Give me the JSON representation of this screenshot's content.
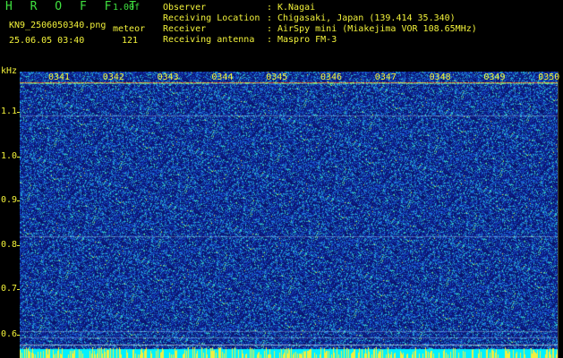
{
  "header": {
    "brand": "H R O F F T",
    "version": "1.00f",
    "filename": "KN9_2506050340.png",
    "timestamp": "25.06.05 03:40",
    "meteor_label": "meteor",
    "meteor_count": "121"
  },
  "metadata": [
    {
      "label": "Observer",
      "value": "K.Nagai"
    },
    {
      "label": "Receiving Location",
      "value": "Chigasaki, Japan (139.414 35.340)"
    },
    {
      "label": "Receiver",
      "value": "AirSpy mini (Miakejima VOR 108.65MHz)"
    },
    {
      "label": "Receiving antenna",
      "value": "Maspro FM-3"
    }
  ],
  "colon": ":",
  "y_axis": {
    "unit": "kHz",
    "ticks": [
      "1.1",
      "1.0",
      "0.9",
      "0.8",
      "0.7",
      "0.6"
    ]
  },
  "x_axis": {
    "ticks": [
      "0341",
      "0342",
      "0343",
      "0344",
      "0345",
      "0346",
      "0347",
      "0348",
      "0349",
      "0350"
    ]
  },
  "colors": {
    "background": "#000000",
    "spectrogram_base": "#112080",
    "label_green": "#3fe03f",
    "label_yellow": "#f2f23a",
    "label_white": "#e8e8e8",
    "bottom_band": "#00ffff"
  }
}
